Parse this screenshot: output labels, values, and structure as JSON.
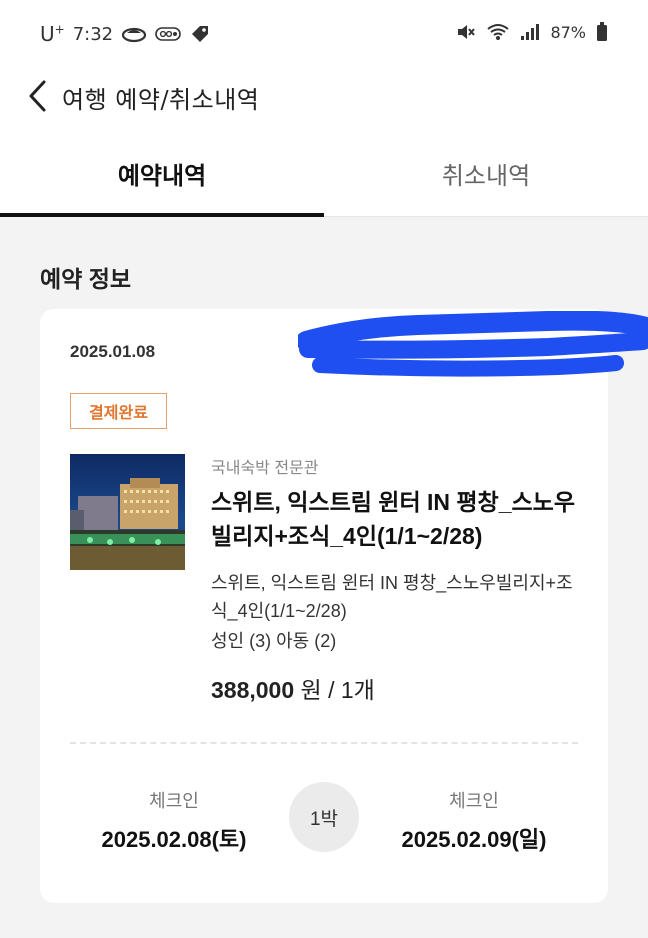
{
  "status_bar": {
    "carrier": "U",
    "carrier_sup": "+",
    "time": "7:32",
    "battery": "87%"
  },
  "header": {
    "title": "여행 예약/취소내역"
  },
  "tabs": [
    {
      "label": "예약내역",
      "active": true
    },
    {
      "label": "취소내역",
      "active": false
    }
  ],
  "section": {
    "title": "예약 정보"
  },
  "reservation": {
    "date": "2025.01.08",
    "status": "결제완료",
    "provider": "국내숙박 전문관",
    "product_title": "스위트, 익스트림 윈터 IN 평창_스노우빌리지+조식_4인(1/1~2/28)",
    "product_desc": "스위트, 익스트림 윈터 IN 평창_스노우빌리지+조식_4인(1/1~2/28)",
    "guests": "성인 (3) 아동 (2)",
    "price": "388,000",
    "price_unit": "원 / 1개",
    "checkin_label": "체크인",
    "checkin_date": "2025.02.08(토)",
    "nights": "1박",
    "checkout_label": "체크인",
    "checkout_date": "2025.02.09(일)"
  },
  "colors": {
    "accent_orange": "#e1762e",
    "redaction_blue": "#1f4ff0"
  }
}
